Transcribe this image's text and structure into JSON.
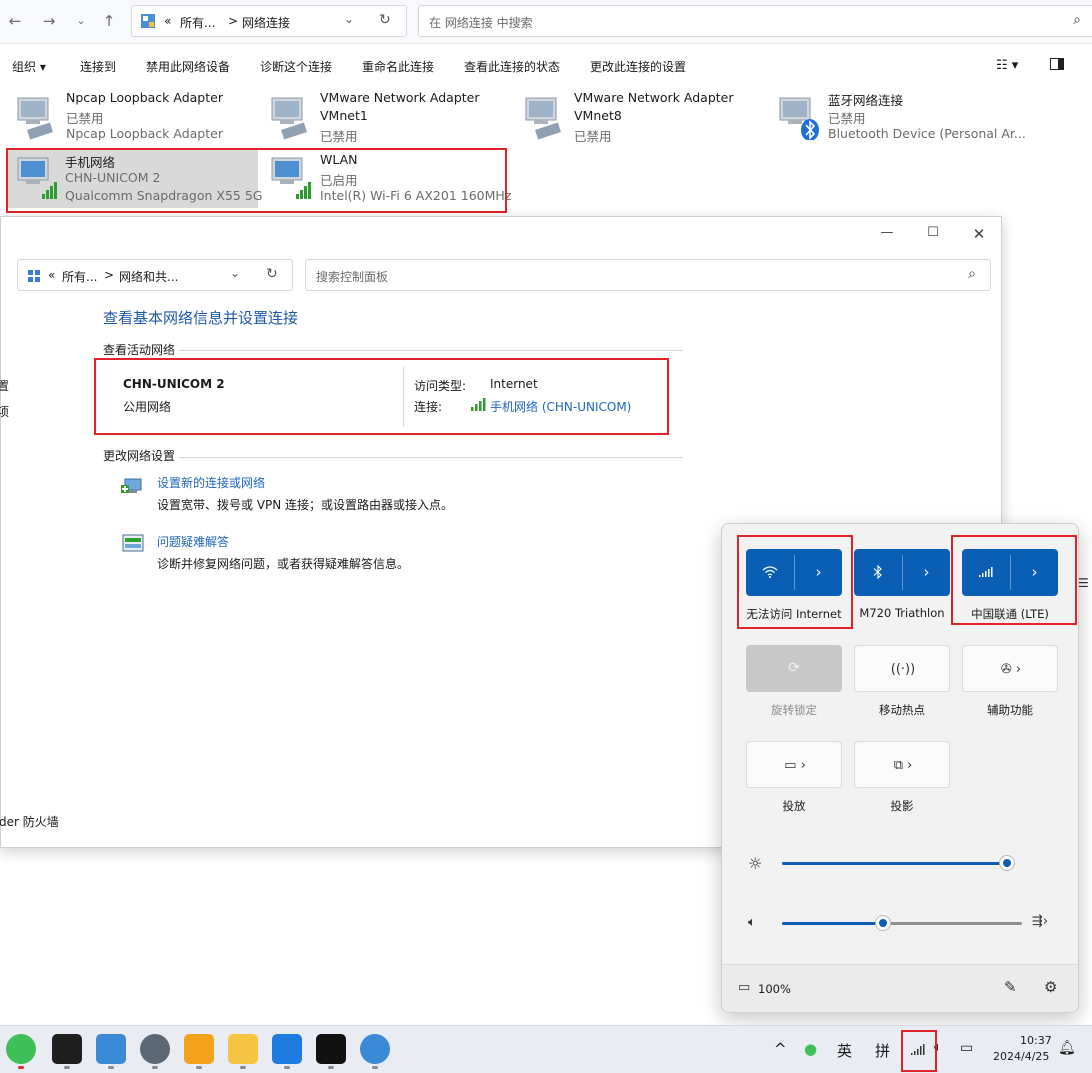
{
  "explorer": {
    "address": {
      "prefix": "«",
      "crumb1": "所有...",
      "sep": ">",
      "crumb2": "网络连接"
    },
    "search_placeholder": "在 网络连接 中搜索",
    "commands": {
      "organize": "组织 ▾",
      "connect": "连接到",
      "disable": "禁用此网络设备",
      "diagnose": "诊断这个连接",
      "rename": "重命名此连接",
      "status": "查看此连接的状态",
      "settings": "更改此连接的设置"
    },
    "adapters": [
      {
        "name": "Npcap Loopback Adapter",
        "status": "已禁用",
        "device": "Npcap Loopback Adapter"
      },
      {
        "name": "VMware Network Adapter VMnet1",
        "line1": "VMware Network Adapter",
        "status_line": "VMnet1",
        "status": "已禁用"
      },
      {
        "name": "VMware Network Adapter VMnet8",
        "line1": "VMware Network Adapter",
        "status_line": "VMnet8",
        "status": "已禁用"
      },
      {
        "name": "蓝牙网络连接",
        "status": "已禁用",
        "device": "Bluetooth Device (Personal Ar..."
      },
      {
        "name": "手机网络",
        "status": "CHN-UNICOM 2",
        "device": "Qualcomm Snapdragon X55 5G"
      },
      {
        "name": "WLAN",
        "status": "已启用",
        "device": "Intel(R) Wi-Fi 6 AX201 160MHz"
      }
    ]
  },
  "control_panel": {
    "address": {
      "prefix": "«",
      "crumb1": "所有...",
      "sep": ">",
      "crumb2": "网络和共..."
    },
    "search_placeholder": "搜索控制面板",
    "title": "查看基本网络信息并设置连接",
    "active_networks_header": "查看活动网络",
    "network_name": "CHN-UNICOM 2",
    "network_type": "公用网络",
    "access_type_label": "访问类型:",
    "access_type_value": "Internet",
    "connection_label": "连接:",
    "connection_value": "手机网络 (CHN-UNICOM)",
    "change_settings_header": "更改网络设置",
    "setup_link": "设置新的连接或网络",
    "setup_desc": "设置宽带、拨号或 VPN 连接；或设置路由器或接入点。",
    "troubleshoot_link": "问题疑难解答",
    "troubleshoot_desc": "诊断并修复网络问题，或者获得疑难解答信息。",
    "left_fragment_1": "置",
    "left_fragment_2": "项",
    "left_fragment_3": "der 防火墙"
  },
  "quick_settings": {
    "wifi_label": "无法访问 Internet",
    "bluetooth_label": "M720 Triathlon",
    "cellular_label": "中国联通 (LTE)",
    "rotation_label": "旋转锁定",
    "hotspot_label": "移动热点",
    "accessibility_label": "辅助功能",
    "cast_label": "投放",
    "project_label": "投影",
    "brightness": 0.97,
    "volume": 0.42,
    "battery": "100%"
  },
  "taskbar": {
    "ime_lang": "英",
    "ime_mode": "拼",
    "time": "10:37",
    "date": "2024/4/25"
  },
  "colors": {
    "accent": "#0a5fb4",
    "link": "#1e66c4",
    "highlight_box": "#e0242a"
  }
}
